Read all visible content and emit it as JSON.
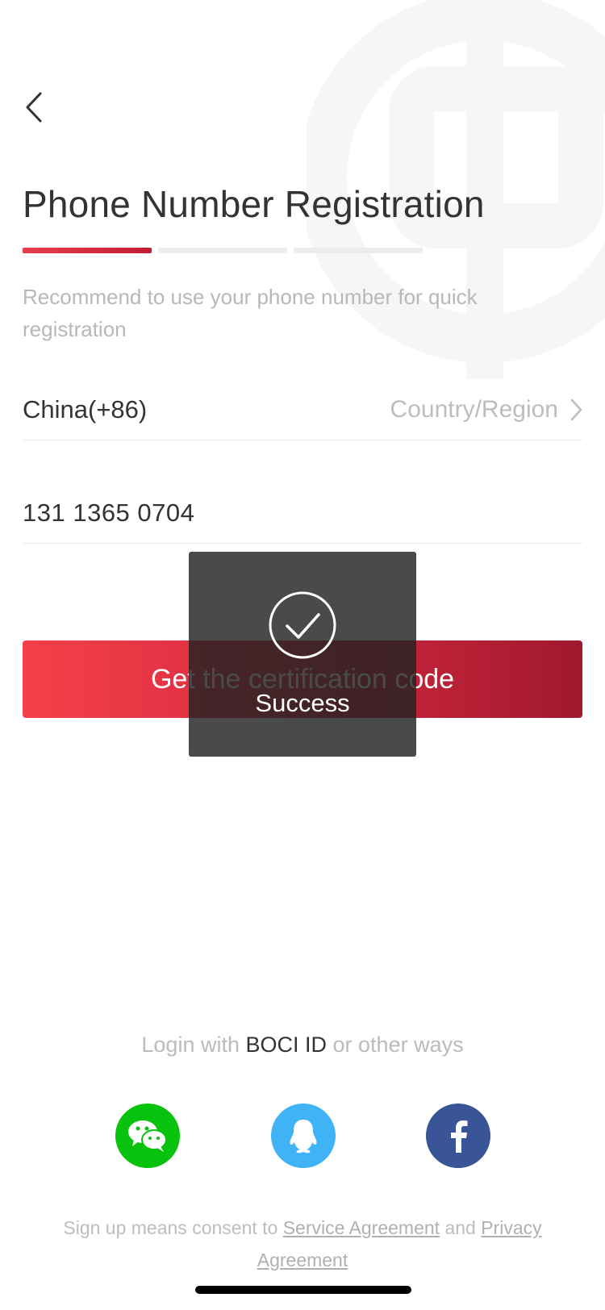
{
  "header": {
    "back_icon": "chevron-left-icon",
    "title": "Phone Number Registration",
    "progress": {
      "total_steps": 3,
      "current_step": 1
    }
  },
  "subtitle": "Recommend to use your phone number for quick registration",
  "country": {
    "value": "China(+86)",
    "label": "Country/Region",
    "icon": "chevron-right-icon"
  },
  "phone": {
    "value": "131 1365 0704"
  },
  "cta": {
    "label": "Get the certification code"
  },
  "toast": {
    "icon": "check-circle-icon",
    "text": "Success"
  },
  "login": {
    "prefix": "Login with",
    "brand": "BOCI ID",
    "suffix": "or other ways",
    "methods": [
      "wechat-icon",
      "qq-icon",
      "facebook-icon"
    ]
  },
  "consent": {
    "prefix": "Sign up means consent to",
    "service_link": "Service Agreement",
    "and": "and",
    "privacy_link": "Privacy Agreement"
  },
  "colors": {
    "accent_start": "#f5404a",
    "accent_end": "#a0182e",
    "wechat": "#09c20e",
    "qq": "#3fb3f5",
    "facebook": "#3a5597"
  }
}
